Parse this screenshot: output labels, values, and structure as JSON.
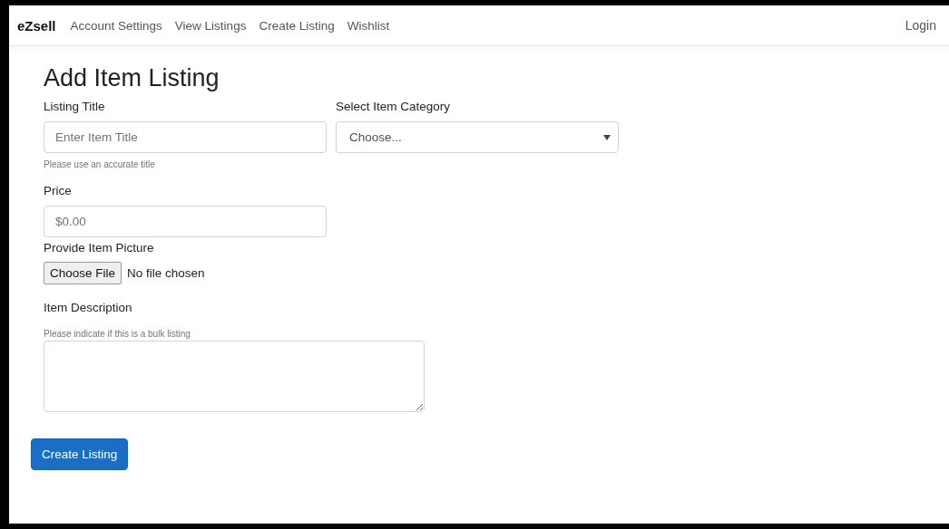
{
  "navbar": {
    "brand": "eZsell",
    "links": [
      "Account Settings",
      "View Listings",
      "Create Listing",
      "Wishlist"
    ],
    "login": "Login"
  },
  "page_title": "Add Item Listing",
  "form": {
    "title_field": {
      "label": "Listing Title",
      "placeholder": "Enter Item Title",
      "help": "Please use an accurate title"
    },
    "category": {
      "label": "Select Item Category",
      "value": "Choose..."
    },
    "price": {
      "label": "Price",
      "placeholder": "$0.00"
    },
    "picture": {
      "label": "Provide Item Picture",
      "button": "Choose File",
      "status": "No file chosen"
    },
    "description": {
      "label": "Item Description",
      "help": "Please indicate if this is a bulk listing"
    },
    "submit": "Create Listing"
  }
}
